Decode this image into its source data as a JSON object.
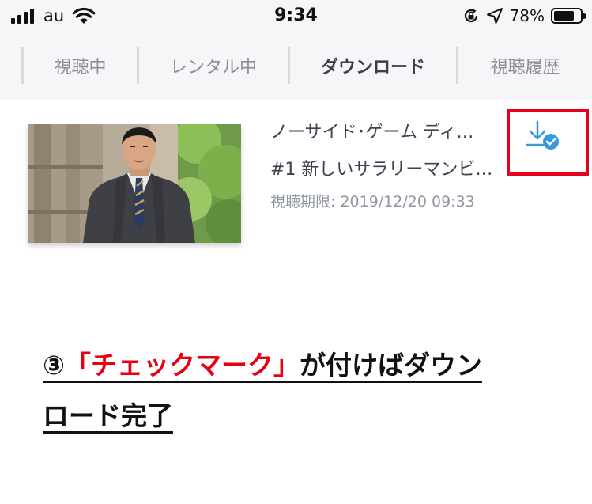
{
  "status_bar": {
    "carrier": "au",
    "time": "9:34",
    "battery_percent": "78%",
    "battery_level": 0.78
  },
  "tabs": [
    {
      "label": "視聴中",
      "active": false
    },
    {
      "label": "レンタル中",
      "active": false
    },
    {
      "label": "ダウンロード",
      "active": true
    },
    {
      "label": "視聴履歴",
      "active": false
    }
  ],
  "download_item": {
    "title": "ノーサイド･ゲーム ディ…",
    "episode": "#1 新しいサラリーマンビ…",
    "expiry": "視聴期限: 2019/12/20 09:33",
    "status_icon": "download-complete-icon"
  },
  "caption": {
    "number": "③",
    "highlight": "「チェックマーク」",
    "line1_rest": "が付けばダウン",
    "line2": "ロード完了"
  },
  "colors": {
    "accent_blue": "#3a9bdc",
    "highlight_red": "#e60012",
    "tab_bar_bg": "#f6f6f8"
  }
}
